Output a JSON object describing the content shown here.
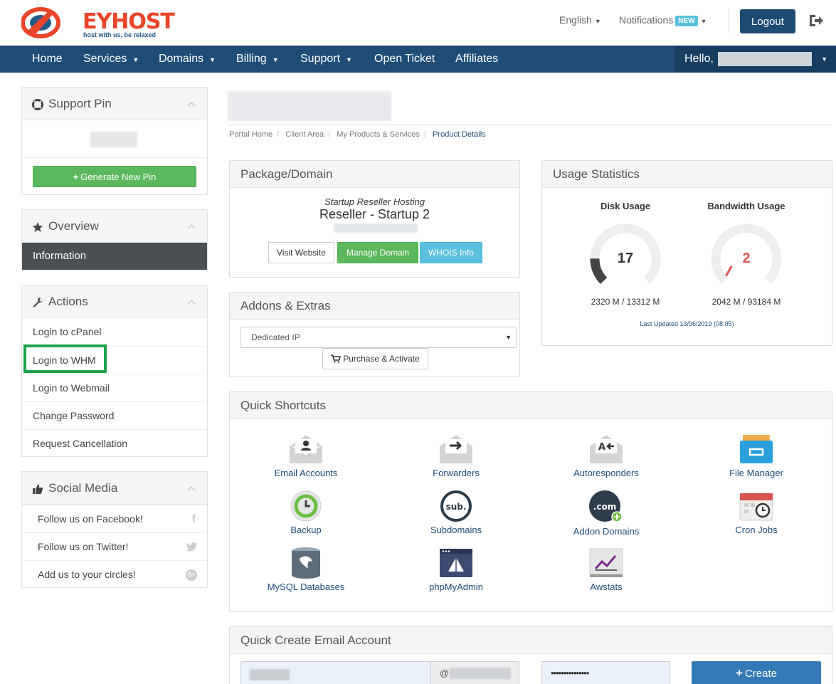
{
  "brand": {
    "name": "EYHOST",
    "tagline": "host with us, be relaxed",
    "primary_color": "#1f4d78",
    "accent_color": "#e8452a"
  },
  "header": {
    "language": "English",
    "notifications_label": "Notifications",
    "notifications_badge": "NEW",
    "logout_label": "Logout",
    "exit_icon": "sign-out-icon"
  },
  "nav": {
    "items": [
      {
        "label": "Home",
        "dropdown": false
      },
      {
        "label": "Services",
        "dropdown": true
      },
      {
        "label": "Domains",
        "dropdown": true
      },
      {
        "label": "Billing",
        "dropdown": true
      },
      {
        "label": "Support",
        "dropdown": true
      },
      {
        "label": "Open Ticket",
        "dropdown": false
      },
      {
        "label": "Affiliates",
        "dropdown": false
      }
    ],
    "hello_label": "Hello,"
  },
  "sidebar": {
    "support_pin": {
      "title": "Support Pin",
      "generate_label": "Generate New Pin"
    },
    "overview": {
      "title": "Overview",
      "items": [
        "Information"
      ]
    },
    "actions": {
      "title": "Actions",
      "items": [
        "Login to cPanel",
        "Login to WHM",
        "Login to Webmail",
        "Change Password",
        "Request Cancellation"
      ]
    },
    "social": {
      "title": "Social Media",
      "items": [
        "Follow us on Facebook!",
        "Follow us on Twitter!",
        "Add us to your circles!"
      ]
    }
  },
  "breadcrumb": [
    "Portal Home",
    "Client Area",
    "My Products & Services",
    "Product Details"
  ],
  "package": {
    "title": "Package/Domain",
    "group": "Startup Reseller Hosting",
    "name": "Reseller - Startup 2",
    "buttons": [
      "Visit Website",
      "Manage Domain",
      "WHOIS Info"
    ]
  },
  "addons": {
    "title": "Addons & Extras",
    "selected": "Dedicated IP",
    "purchase_label": "Purchase & Activate"
  },
  "usage": {
    "title": "Usage Statistics",
    "disk": {
      "label": "Disk Usage",
      "percent": 17,
      "detail": "2320 M / 13312 M"
    },
    "bandwidth": {
      "label": "Bandwidth Usage",
      "percent": 2,
      "detail": "2042 M / 93184 M"
    },
    "updated": "Last Updated 13/06/2019 (08:05)"
  },
  "shortcuts": {
    "title": "Quick Shortcuts",
    "items": [
      {
        "label": "Email Accounts",
        "icon": "email-accounts-icon"
      },
      {
        "label": "Forwarders",
        "icon": "forwarders-icon"
      },
      {
        "label": "Autoresponders",
        "icon": "autoresponders-icon"
      },
      {
        "label": "File Manager",
        "icon": "file-manager-icon"
      },
      {
        "label": "Backup",
        "icon": "backup-icon"
      },
      {
        "label": "Subdomains",
        "icon": "subdomains-icon"
      },
      {
        "label": "Addon Domains",
        "icon": "addon-domains-icon"
      },
      {
        "label": "Cron Jobs",
        "icon": "cron-jobs-icon"
      },
      {
        "label": "MySQL Databases",
        "icon": "mysql-icon"
      },
      {
        "label": "phpMyAdmin",
        "icon": "phpmyadmin-icon"
      },
      {
        "label": "Awstats",
        "icon": "awstats-icon"
      }
    ],
    "subdomain_icon_text": "sub.",
    "addon_icon_text": ".com"
  },
  "quick_create": {
    "title": "Quick Create Email Account",
    "at_symbol": "@",
    "password_mask": "•••••••••••••••",
    "create_label": "Create"
  }
}
